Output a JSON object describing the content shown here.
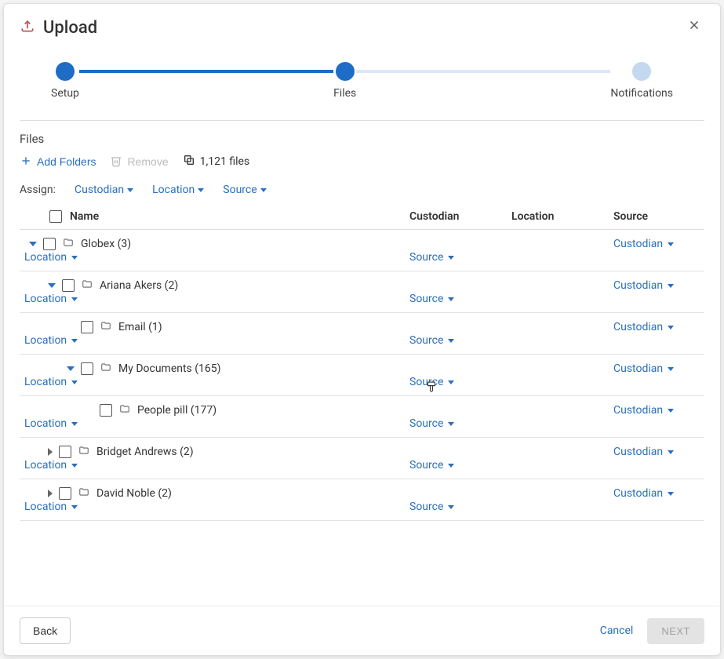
{
  "dialog": {
    "title": "Upload",
    "steps": [
      "Setup",
      "Files",
      "Notifications"
    ],
    "active_step_index": 1
  },
  "section": {
    "title": "Files"
  },
  "toolbar": {
    "add_folders": "Add Folders",
    "remove": "Remove",
    "file_count": "1,121 files"
  },
  "assign": {
    "label": "Assign:",
    "custodian": "Custodian",
    "location": "Location",
    "source": "Source"
  },
  "columns": {
    "name": "Name",
    "custodian": "Custodian",
    "location": "Location",
    "source": "Source"
  },
  "row_dropdowns": {
    "custodian": "Custodian",
    "location": "Location",
    "source": "Source"
  },
  "rows": [
    {
      "indent": 0,
      "expanded": true,
      "name": "Globex (3)"
    },
    {
      "indent": 1,
      "expanded": true,
      "name": "Ariana Akers (2)"
    },
    {
      "indent": 2,
      "expanded": null,
      "name": "Email (1)"
    },
    {
      "indent": 2,
      "expanded": true,
      "name": "My Documents (165)"
    },
    {
      "indent": 3,
      "expanded": null,
      "name": "People pill (177)"
    },
    {
      "indent": 1,
      "expanded": false,
      "name": "Bridget Andrews (2)"
    },
    {
      "indent": 1,
      "expanded": false,
      "name": "David Noble (2)"
    }
  ],
  "footer": {
    "back": "Back",
    "cancel": "Cancel",
    "next": "NEXT"
  }
}
